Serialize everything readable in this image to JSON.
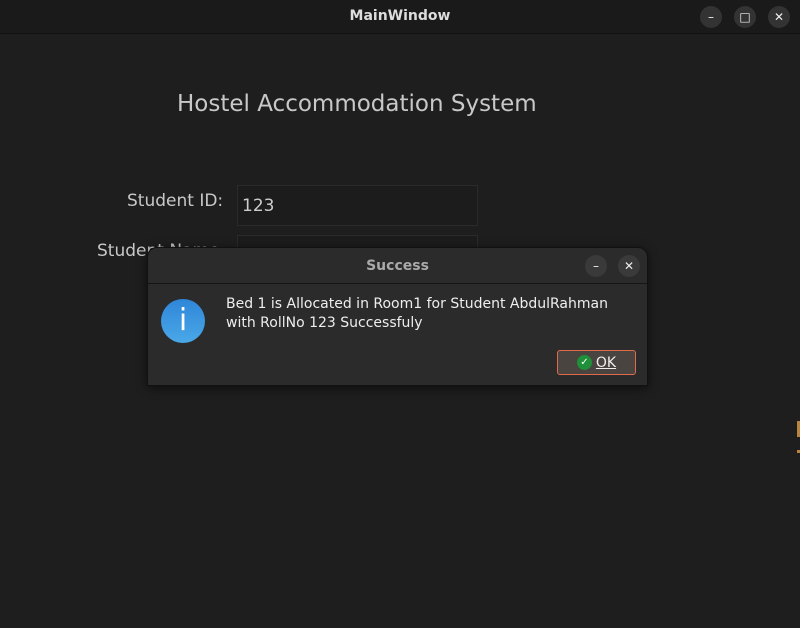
{
  "window": {
    "title": "MainWindow",
    "minimize": "–",
    "maximize": "□",
    "close": "✕"
  },
  "main": {
    "heading": "Hostel  Accommodation System",
    "student_id_label": "Student ID:",
    "student_id_value": "123",
    "student_name_label": "Student Name:",
    "student_name_value": ""
  },
  "dialog": {
    "title": "Success",
    "minimize": "–",
    "close": "✕",
    "icon": "info-icon",
    "icon_glyph": "i",
    "message": "Bed 1 is Allocated in Room1 for Student AbdulRahman with RollNo 123 Successfuly",
    "ok_label": "OK",
    "ok_check": "✓"
  },
  "colors": {
    "accent": "#e06a4b",
    "info": "#3a97e0",
    "success": "#1f8f3a"
  }
}
